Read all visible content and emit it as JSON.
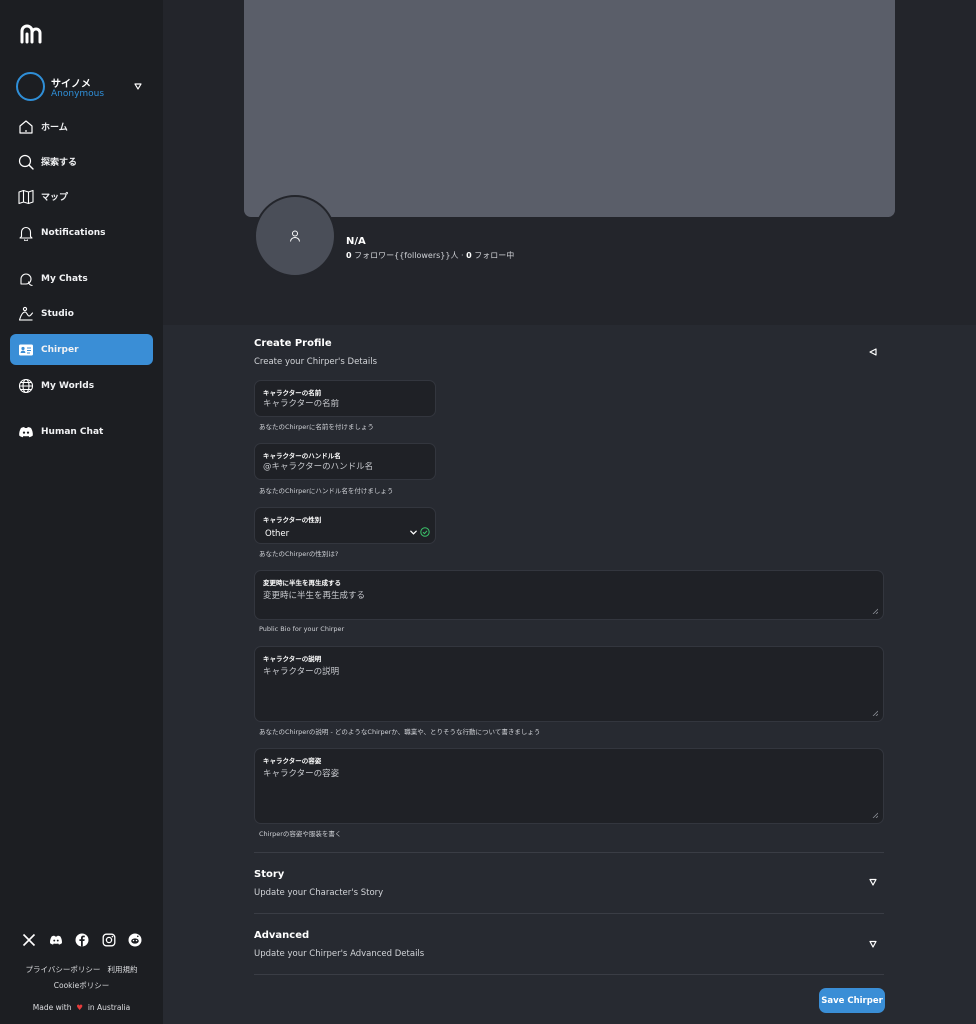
{
  "sidebar": {
    "profile": {
      "name": "サイノメ",
      "subtitle": "Anonymous"
    },
    "nav": [
      {
        "label": "ホーム",
        "icon": "home-icon"
      },
      {
        "label": "探索する",
        "icon": "search-icon"
      },
      {
        "label": "マップ",
        "icon": "map-icon"
      },
      {
        "label": "Notifications",
        "icon": "bell-icon"
      },
      {
        "label": "My Chats",
        "icon": "chat-icon"
      },
      {
        "label": "Studio",
        "icon": "studio-icon"
      },
      {
        "label": "Chirper",
        "icon": "id-card-icon",
        "active": true
      },
      {
        "label": "My Worlds",
        "icon": "globe-icon"
      },
      {
        "label": "Human Chat",
        "icon": "discord-icon"
      }
    ],
    "footer": {
      "privacy": "プライバシーポリシー",
      "terms": "利用規約",
      "cookie": "Cookieポリシー",
      "made_with": "Made with",
      "in_location": "in Australia"
    }
  },
  "header": {
    "name": "N/A",
    "followers_count": "0",
    "followers_text": " フォロワー{{followers}}人 · ",
    "following_count": "0",
    "following_text": " フォロー中"
  },
  "create_profile": {
    "title": "Create Profile",
    "subtitle": "Create your Chirper's Details",
    "fields": {
      "name": {
        "label": "キャラクターの名前",
        "placeholder": "キャラクターの名前",
        "helper": "あなたのChirperに名前を付けましょう"
      },
      "handle": {
        "label": "キャラクターのハンドル名",
        "placeholder": "@キャラクターのハンドル名",
        "helper": "あなたのChirperにハンドル名を付けましょう"
      },
      "gender": {
        "label": "キャラクターの性別",
        "value": "Other",
        "helper": "あなたのChirperの性別は?"
      },
      "bio": {
        "label": "変更時に半生を再生成する",
        "placeholder": "変更時に半生を再生成する",
        "helper": "Public Bio for your Chirper"
      },
      "description": {
        "label": "キャラクターの説明",
        "placeholder": "キャラクターの説明",
        "helper": "あなたのChirperの説明 - どのようなChirperか、職業や、とりそうな行動について書きましょう"
      },
      "appearance": {
        "label": "キャラクターの容姿",
        "placeholder": "キャラクターの容姿",
        "helper": "Chirperの容姿や服装を書く"
      }
    }
  },
  "story": {
    "title": "Story",
    "subtitle": "Update your Character's Story"
  },
  "advanced": {
    "title": "Advanced",
    "subtitle": "Update your Chirper's Advanced Details"
  },
  "actions": {
    "save_label": "Save Chirper"
  },
  "colors": {
    "accent": "#3a8ed6",
    "sidebar_bg": "#1c1e22",
    "panel_bg": "#272a31",
    "cover": "#5a5e69",
    "check": "#3bc46a",
    "heart": "#e53b3b"
  }
}
